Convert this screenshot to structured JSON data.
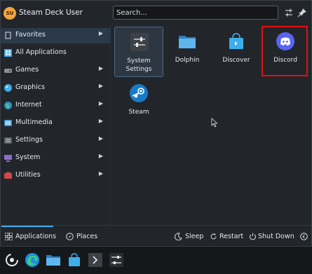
{
  "header": {
    "avatar_initials": "SU",
    "user_name": "Steam Deck User",
    "search_placeholder": "Search...",
    "config_icon": "sliders-icon",
    "pin_icon": "pin-icon"
  },
  "sidebar": {
    "items": [
      {
        "label": "Favorites",
        "icon": "bookmark-icon"
      },
      {
        "label": "All Applications",
        "icon": "grid-icon"
      },
      {
        "label": "Games",
        "icon": "gamepad-icon"
      },
      {
        "label": "Graphics",
        "icon": "graphics-icon"
      },
      {
        "label": "Internet",
        "icon": "globe-icon"
      },
      {
        "label": "Multimedia",
        "icon": "multimedia-icon"
      },
      {
        "label": "Settings",
        "icon": "settings-icon"
      },
      {
        "label": "System",
        "icon": "system-icon"
      },
      {
        "label": "Utilities",
        "icon": "utilities-icon"
      }
    ]
  },
  "apps": [
    {
      "name": "System Settings",
      "icon": "system-settings-icon"
    },
    {
      "name": "Dolphin",
      "icon": "folder-icon"
    },
    {
      "name": "Discover",
      "icon": "discover-bag-icon"
    },
    {
      "name": "Discord",
      "icon": "discord-icon"
    },
    {
      "name": "Steam",
      "icon": "steam-icon"
    }
  ],
  "footer": {
    "applications_label": "Applications",
    "places_label": "Places",
    "sleep_label": "Sleep",
    "restart_label": "Restart",
    "shutdown_label": "Shut Down"
  },
  "taskbar": {
    "items": [
      "steam-launcher-icon",
      "edge-browser-icon",
      "file-manager-icon",
      "store-icon",
      "terminal-icon",
      "mixer-icon"
    ]
  },
  "colors": {
    "accent": "#3daee9",
    "highlight_box": "#e01010",
    "avatar": "#f2a53d",
    "discord": "#5865f2"
  }
}
